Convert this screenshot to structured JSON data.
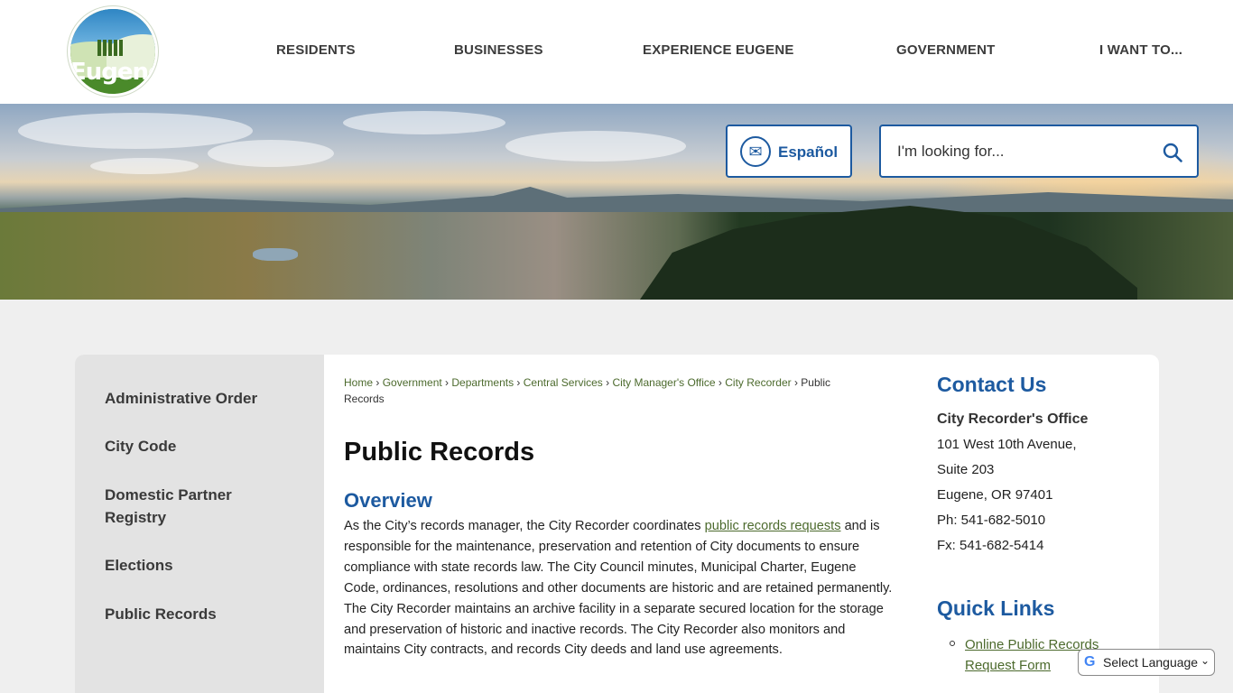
{
  "logo": {
    "text": "Eugene"
  },
  "nav": [
    "RESIDENTS",
    "BUSINESSES",
    "EXPERIENCE EUGENE",
    "GOVERNMENT",
    "I WANT TO..."
  ],
  "language_button": {
    "label": "Español",
    "icon": "translate-icon"
  },
  "search": {
    "placeholder": "I'm looking for...",
    "icon": "search-icon"
  },
  "sidebar": {
    "items": [
      "Administrative Order",
      "City Code",
      "Domestic Partner Registry",
      "Elections",
      "Public Records"
    ]
  },
  "breadcrumb": {
    "links": [
      "Home",
      "Government",
      "Departments",
      "Central Services",
      "City Manager's Office",
      "City Recorder"
    ],
    "current": "Public Records"
  },
  "main": {
    "title": "Public Records",
    "section_heading": "Overview",
    "para_before": "As the City’s records manager, the City Recorder coordinates ",
    "para_link": "public records requests",
    "para_after": " and is responsible for the maintenance, preservation and retention of City documents to ensure compliance with state records law. The City Council minutes, Municipal Charter, Eugene Code, ordinances, resolutions and other documents are historic and are retained permanently. The City Recorder maintains an archive facility in a separate secured location for the storage and preservation of historic and inactive records. The City Recorder also monitors and maintains City contracts, and records City deeds and land use agreements."
  },
  "contact": {
    "heading": "Contact Us",
    "office": "City Recorder's Office",
    "address1": "101 West 10th Avenue,",
    "address2": "Suite 203",
    "city": "Eugene, OR 97401",
    "phone": "Ph: 541-682-5010",
    "fax": "Fx: 541-682-5414"
  },
  "quick_links": {
    "heading": "Quick Links",
    "items": [
      "Online Public Records Request Form"
    ]
  },
  "translate": {
    "label": "Select Language",
    "logo": "G"
  },
  "colors": {
    "accent": "#1d5aa0",
    "link": "#4c6a2d",
    "sidebar_bg": "#e3e3e3",
    "page_bg": "#efefef"
  }
}
